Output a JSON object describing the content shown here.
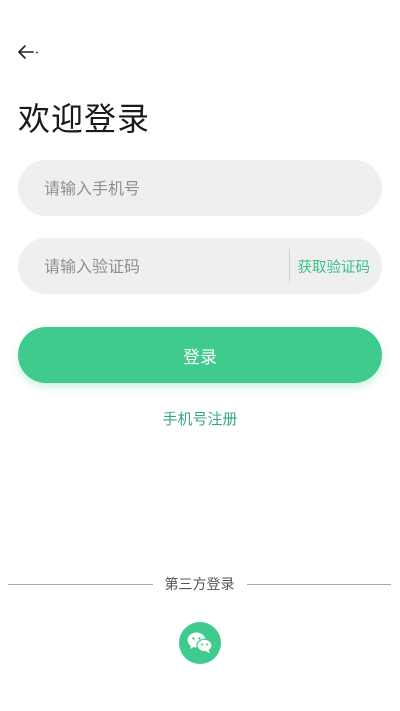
{
  "header": {
    "back_icon": "arrow-left-icon"
  },
  "title": "欢迎登录",
  "phone_field": {
    "placeholder": "请输入手机号",
    "value": ""
  },
  "code_field": {
    "placeholder": "请输入验证码",
    "value": "",
    "get_code_label": "获取验证码"
  },
  "login_button": {
    "label": "登录"
  },
  "register_link": {
    "label": "手机号注册"
  },
  "third_party": {
    "label": "第三方登录",
    "wechat_icon": "wechat-icon"
  },
  "colors": {
    "accent": "#3ecb8d",
    "accent_text": "#3bbf8a",
    "field_bg": "#efefef"
  }
}
